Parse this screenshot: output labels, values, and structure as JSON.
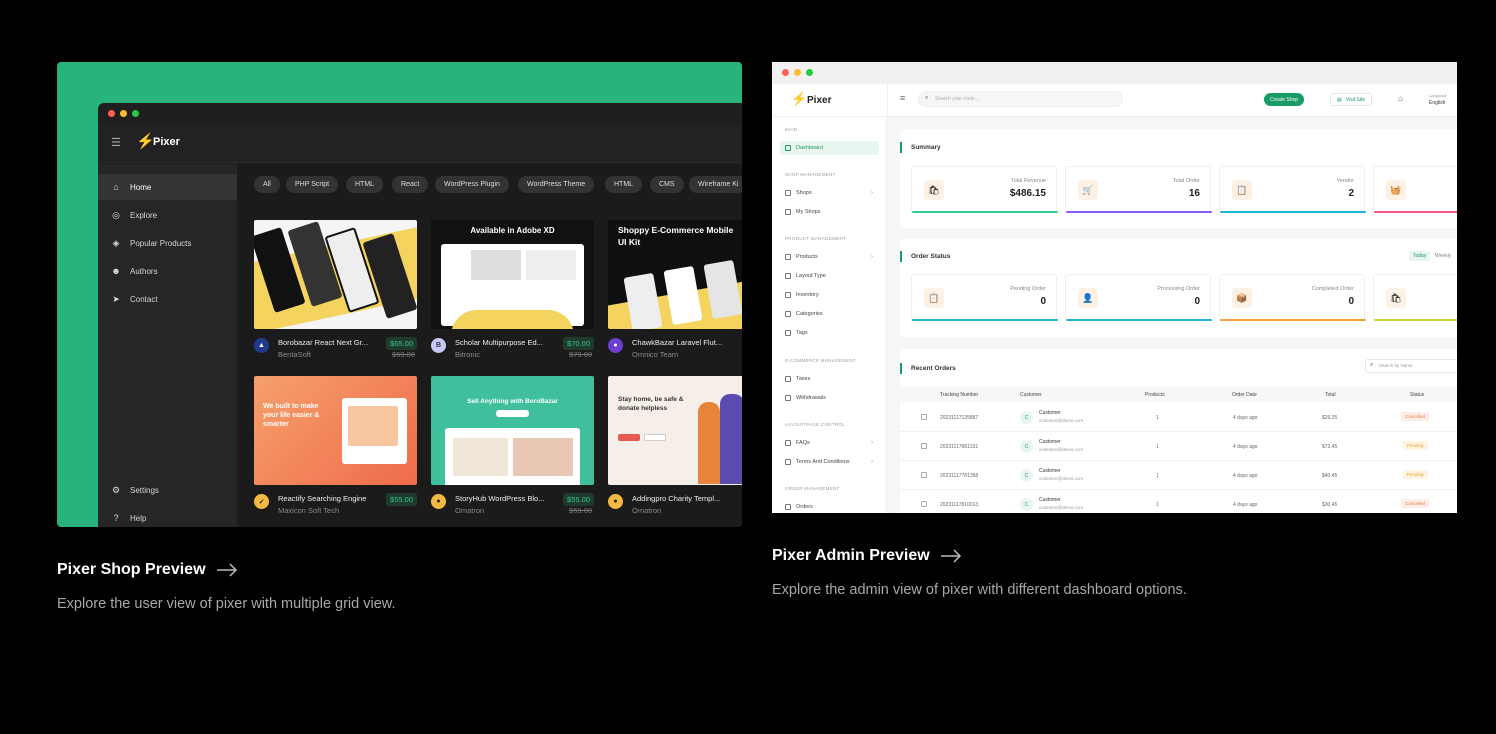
{
  "shop": {
    "brand": "Pixer",
    "sidebar": [
      {
        "label": "Home",
        "icon": "home-icon"
      },
      {
        "label": "Explore",
        "icon": "compass-icon"
      },
      {
        "label": "Popular Products",
        "icon": "cube-icon"
      },
      {
        "label": "Authors",
        "icon": "users-icon"
      },
      {
        "label": "Contact",
        "icon": "send-icon"
      }
    ],
    "sidebar_bottom": [
      {
        "label": "Settings",
        "icon": "gear-icon"
      },
      {
        "label": "Help",
        "icon": "help-icon"
      }
    ],
    "chips": [
      "All",
      "PHP Script",
      "HTML",
      "React",
      "WordPress Plugin",
      "WordPress Theme",
      "HTML",
      "CMS",
      "Wireframe Ki"
    ],
    "products": [
      {
        "name": "Borobazar React Next Gr...",
        "author": "BentaSoft",
        "price": "$65.00",
        "old": "$69.00",
        "avatar": "",
        "thumb_text": ""
      },
      {
        "name": "Scholar Multipurpose Ed...",
        "author": "Bitronic",
        "price": "$70.00",
        "old": "$79.00",
        "avatar": "B",
        "thumb_text": "Available in Adobe XD"
      },
      {
        "name": "ChawkBazar Laravel Flut...",
        "author": "Omnico Team",
        "price": "",
        "old": "",
        "avatar": "",
        "thumb_text": "Shoppy E-Commerce Mobile UI Kit"
      },
      {
        "name": "Reactify Searching Engine",
        "author": "Maxicon Soft Tech",
        "price": "$55.00",
        "old": "",
        "avatar": "",
        "thumb_text": "We built to make your life easier & smarter"
      },
      {
        "name": "StoryHub WordPress Blo...",
        "author": "Omatron",
        "price": "$55.00",
        "old": "$59.00",
        "avatar": "",
        "thumb_text": "Sell Anything with BoroBazar"
      },
      {
        "name": "Addingpro Charity Templ...",
        "author": "Omatron",
        "price": "",
        "old": "",
        "avatar": "",
        "thumb_text": "Stay home, be safe & donate helpless"
      }
    ]
  },
  "admin": {
    "brand": "Pixer",
    "search_placeholder": "Search your route...",
    "create_shop": "Create Shop",
    "visit_site": "Visit Site",
    "language_label": "Language",
    "language_value": "English",
    "sidebar": {
      "main_label": "MAIN",
      "dashboard": "Dashboard",
      "shop_mgmt_label": "SHOP MANAGEMENT",
      "shops": "Shops",
      "my_shops": "My Shops",
      "product_mgmt_label": "PRODUCT MANAGEMENT",
      "products": "Products",
      "layout_type": "Layout Type",
      "inventory": "Inventory",
      "categories": "Categories",
      "tags": "Tags",
      "ecom_mgmt_label": "E-COMMERCE MANAGEMENT",
      "taxes": "Taxes",
      "withdrawals": "Withdrawals",
      "layout_control_label": "LAYOUT/PAGE CONTROL",
      "faqs": "FAQs",
      "terms": "Terms And Conditions",
      "order_mgmt_label": "ORDER MANAGEMENT",
      "orders": "Orders"
    },
    "summary": {
      "title": "Summary",
      "cards": [
        {
          "label": "Total Revenue",
          "value": "$486.15",
          "color": "#2ecc8f"
        },
        {
          "label": "Total Order",
          "value": "16",
          "color": "#8b5cf6"
        },
        {
          "label": "Vendor",
          "value": "2",
          "color": "#1fb6d6"
        },
        {
          "label": "",
          "value": "",
          "color": "#f0568c"
        }
      ]
    },
    "order_status": {
      "title": "Order Status",
      "tab_today": "Today",
      "tab_weekly": "Weekly",
      "cards": [
        {
          "label": "Pending Order",
          "value": "0",
          "color": "#1fb6d6"
        },
        {
          "label": "Processing Order",
          "value": "0",
          "color": "#1fb6d6"
        },
        {
          "label": "Completed Order",
          "value": "0",
          "color": "#f59e3b"
        },
        {
          "label": "",
          "value": "",
          "color": "#c8d432"
        }
      ]
    },
    "recent_orders": {
      "title": "Recent Orders",
      "search_placeholder": "Search by Name",
      "headers": [
        "Tracking Number",
        "Customer",
        "Products",
        "Order Date",
        "Total",
        "Status"
      ],
      "rows": [
        {
          "tracking": "20231117135887",
          "customer": "Customer",
          "email": "customer@demo.com",
          "products": "1",
          "date": "4 days ago",
          "total": "$26.25",
          "status": "Cancelled"
        },
        {
          "tracking": "20231117681331",
          "customer": "Customer",
          "email": "customer@demo.com",
          "products": "1",
          "date": "4 days ago",
          "total": "$72.45",
          "status": "Pending"
        },
        {
          "tracking": "20231117781358",
          "customer": "Customer",
          "email": "customer@demo.com",
          "products": "1",
          "date": "4 days ago",
          "total": "$40.45",
          "status": "Pending"
        },
        {
          "tracking": "20231117810013",
          "customer": "Customer",
          "email": "customer@demo.com",
          "products": "1",
          "date": "4 days ago",
          "total": "$30.45",
          "status": "Cancelled"
        }
      ]
    }
  },
  "captions": {
    "shop_title": "Pixer Shop Preview",
    "shop_desc": "Explore the user view of pixer with multiple grid view.",
    "admin_title": "Pixer Admin Preview",
    "admin_desc": "Explore the admin view of pixer with different dashboard options."
  }
}
